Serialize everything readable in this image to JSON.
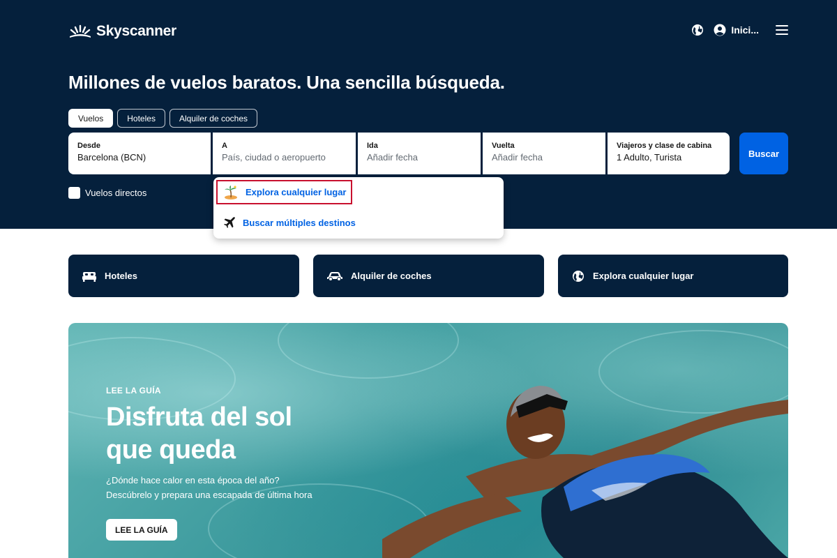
{
  "header": {
    "brand": "Skyscanner",
    "user_label": "Inici..."
  },
  "hero": {
    "headline": "Millones de vuelos baratos. Una sencilla búsqueda.",
    "tabs": [
      {
        "label": "Vuelos",
        "active": true
      },
      {
        "label": "Hoteles",
        "active": false
      },
      {
        "label": "Alquiler de coches",
        "active": false
      }
    ]
  },
  "search": {
    "from": {
      "label": "Desde",
      "value": "Barcelona (BCN)"
    },
    "to": {
      "label": "A",
      "placeholder": "País, ciudad o aeropuerto"
    },
    "depart": {
      "label": "Ida",
      "placeholder": "Añadir fecha"
    },
    "return": {
      "label": "Vuelta",
      "placeholder": "Añadir fecha"
    },
    "travellers": {
      "label": "Viajeros y clase de cabina",
      "value": "1 Adulto, Turista"
    },
    "search_button": "Buscar",
    "direct_flights_label": "Vuelos directos",
    "direct_flights_checked": false
  },
  "dropdown": {
    "items": [
      {
        "label": "Explora cualquier lugar",
        "icon": "palm-island-icon"
      },
      {
        "label": "Buscar múltiples destinos",
        "icon": "plane-icon"
      }
    ]
  },
  "quick_links": [
    {
      "label": "Hoteles",
      "icon": "bed-icon"
    },
    {
      "label": "Alquiler de coches",
      "icon": "car-icon"
    },
    {
      "label": "Explora cualquier lugar",
      "icon": "globe-icon"
    }
  ],
  "promo": {
    "kicker": "LEE LA GUÍA",
    "title": "Disfruta del sol que queda",
    "subtitle_line1": "¿Dónde hace calor en esta época del año?",
    "subtitle_line2": "Descúbrelo y prepara una escapada de última hora",
    "button": "LEE LA GUÍA"
  },
  "colors": {
    "navy": "#05203c",
    "primary_blue": "#0062e3",
    "highlight_red": "#c8102e"
  }
}
